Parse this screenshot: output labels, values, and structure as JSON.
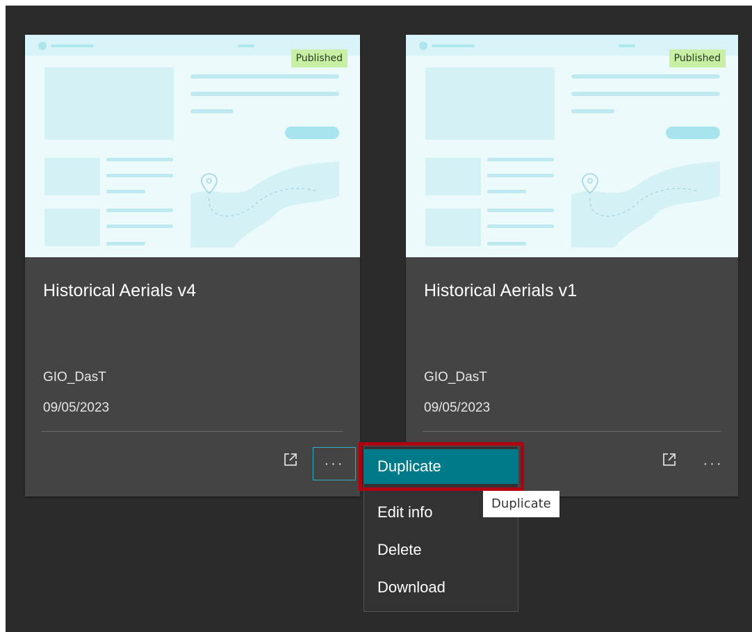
{
  "cards": [
    {
      "badge": "Published",
      "title": "Historical Aerials v4",
      "owner": "GIO_DasT",
      "date": "09/05/2023",
      "more_label": "···"
    },
    {
      "badge": "Published",
      "title": "Historical Aerials v1",
      "owner": "GIO_DasT",
      "date": "09/05/2023",
      "more_label": "···"
    }
  ],
  "menu": {
    "items": [
      {
        "label": "Duplicate",
        "active": true
      },
      {
        "label": "Edit info"
      },
      {
        "label": "Delete"
      },
      {
        "label": "Download"
      }
    ]
  },
  "tooltip": "Duplicate",
  "colors": {
    "background": "#2b2b2b",
    "card": "#444444",
    "badge": "#c7f0a4",
    "thumbnail": "#e9f9fb",
    "thumbnail_shape": "#cfeff4",
    "accent": "#007a88",
    "focus_outline": "#2fb2c8",
    "highlight": "#b00010"
  },
  "icons": {
    "open": "external-link-icon",
    "more": "ellipsis-icon"
  }
}
